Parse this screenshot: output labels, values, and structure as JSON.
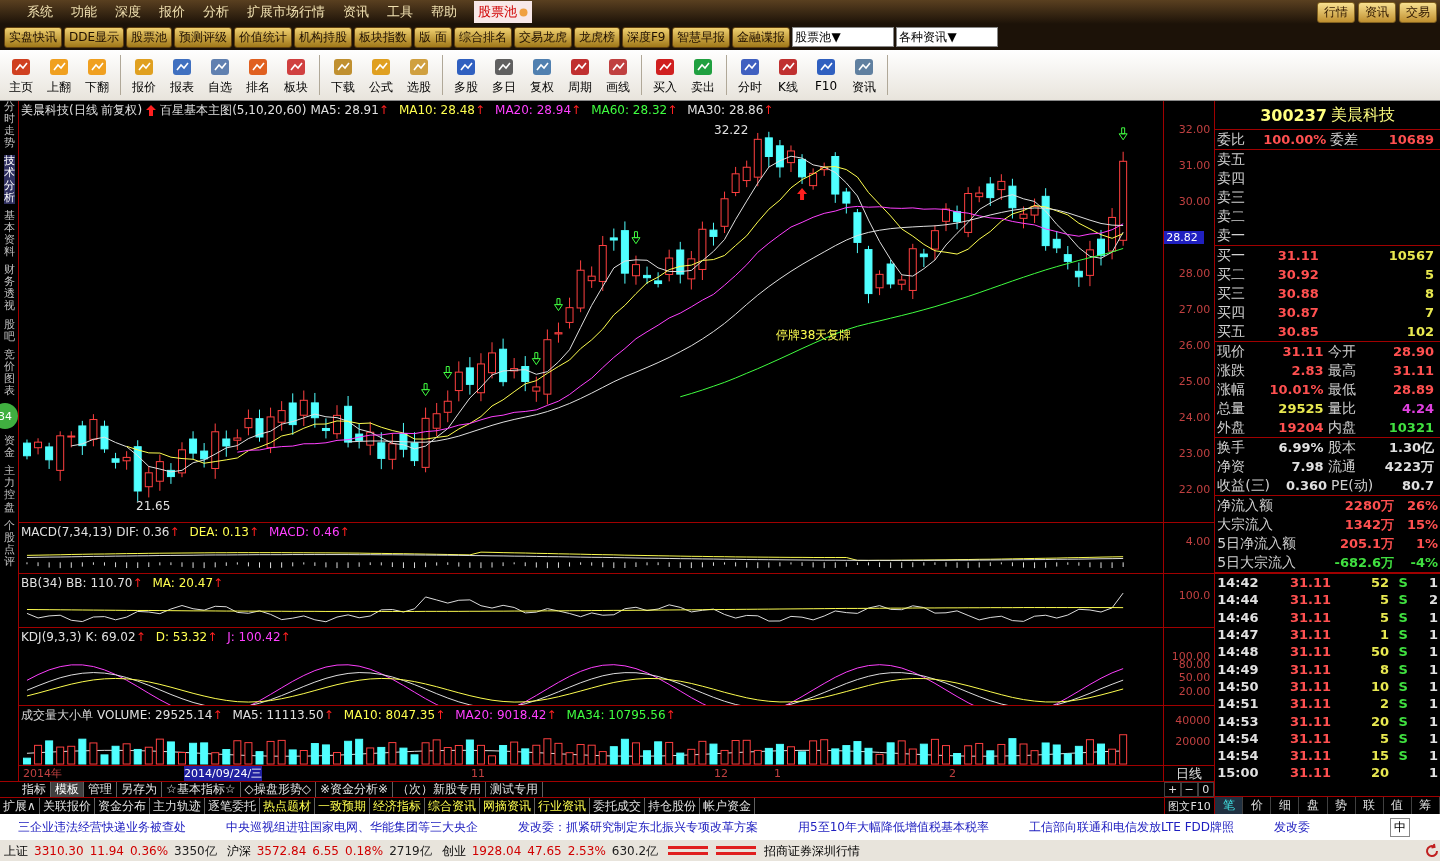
{
  "menu": {
    "items": [
      "系统",
      "功能",
      "深度",
      "报价",
      "分析",
      "扩展市场行情",
      "资讯",
      "工具",
      "帮助"
    ],
    "tab": {
      "label": "股票池",
      "selected": true
    },
    "right_buttons": [
      "行情",
      "资讯",
      "交易"
    ]
  },
  "quickbar": {
    "buttons": [
      "实盘快讯",
      "DDE显示",
      "股票池",
      "预测评级",
      "价值统计",
      "机构持股",
      "板块指数",
      "版 面",
      "综合排名",
      "交易龙虎",
      "龙虎榜",
      "深度F9",
      "智慧早报",
      "金融谍报"
    ],
    "selects": [
      "股票池▼",
      "各种资讯▼"
    ]
  },
  "toolbar": [
    {
      "items": [
        "主页",
        "上翻",
        "下翻"
      ]
    },
    {
      "items": [
        "报价",
        "报表",
        "自选",
        "排名",
        "板块"
      ]
    },
    {
      "items": [
        "下载",
        "公式",
        "选股"
      ]
    },
    {
      "items": [
        "多股",
        "多日",
        "复权",
        "周期",
        "画线"
      ]
    },
    {
      "items": [
        "买入",
        "卖出"
      ]
    },
    {
      "items": [
        "分时",
        "K线",
        "F10",
        "资讯"
      ]
    }
  ],
  "side_tabs": [
    {
      "label": "分时走势",
      "selected": false
    },
    {
      "label": "技术分析",
      "selected": true
    },
    {
      "label": "基本资料",
      "selected": false
    },
    {
      "label": "财务透视",
      "selected": false
    },
    {
      "label": "股吧",
      "selected": false
    },
    {
      "label": "竞价图表",
      "selected": false
    },
    {
      "label": "资金",
      "selected": false
    },
    {
      "label": "主力控盘",
      "selected": false
    },
    {
      "label": "个股点评",
      "selected": false
    }
  ],
  "side_badge": "34",
  "panes": [
    {
      "kind": "price",
      "legend": [
        {
          "label": "美晨科技(日线 前复权)",
          "color": "#e0e0e0"
        },
        {
          "label": "百星基本主图(5,10,20,60)",
          "color": "#e0e0e0",
          "kind": "indicator"
        },
        {
          "label": "MA5: 28.91",
          "color": "#e0e0e0",
          "arrow": "↑"
        },
        {
          "label": "MA10: 28.48",
          "color": "#ffff50",
          "arrow": "↑"
        },
        {
          "label": "MA20: 28.94",
          "color": "#ff40ff",
          "arrow": "↑"
        },
        {
          "label": "MA60: 28.32",
          "color": "#40ff40",
          "arrow": "↑"
        },
        {
          "label": "MA30: 28.86",
          "color": "#e0e0e0",
          "arrow": "↑"
        }
      ],
      "yticks": [
        "32.00",
        "31.00",
        "30.00",
        "28.00",
        "27.00",
        "26.00",
        "25.00",
        "24.00",
        "23.00",
        "22.00"
      ],
      "current": "28.82",
      "annotations": [
        "32.22",
        "21.65",
        "停牌38天复牌"
      ]
    },
    {
      "kind": "macd",
      "legend": [
        {
          "label": "MACD(7,34,13)",
          "color": "#e0e0e0"
        },
        {
          "label": "DIF: 0.36",
          "color": "#e0e0e0",
          "arrow": "↑"
        },
        {
          "label": "DEA: 0.13",
          "color": "#ffff50",
          "arrow": "↑"
        },
        {
          "label": "MACD: 0.46",
          "color": "#ff40ff",
          "arrow": "↑"
        }
      ],
      "yticks": [
        "4.00"
      ]
    },
    {
      "kind": "bb",
      "legend": [
        {
          "label": "BB(34)",
          "color": "#e0e0e0"
        },
        {
          "label": "BB: 110.70",
          "color": "#e0e0e0",
          "arrow": "↑"
        },
        {
          "label": "MA: 20.47",
          "color": "#ffff50",
          "arrow": "↑"
        }
      ],
      "yticks": [
        "100.0"
      ]
    },
    {
      "kind": "kdj",
      "legend": [
        {
          "label": "KDJ(9,3,3)",
          "color": "#e0e0e0"
        },
        {
          "label": "K: 69.02",
          "color": "#e0e0e0",
          "arrow": "↑"
        },
        {
          "label": "D: 53.32",
          "color": "#ffff50",
          "arrow": "↑"
        },
        {
          "label": "J: 100.42",
          "color": "#ff40ff",
          "arrow": "↑"
        }
      ],
      "yticks": [
        "100.00",
        "80.00",
        "50.00",
        "20.00"
      ]
    },
    {
      "kind": "volume",
      "legend": [
        {
          "label": "成交量大小单"
        },
        {
          "label": "VOLUME: 29525.14",
          "color": "#e0e0e0",
          "arrow": "↑"
        },
        {
          "label": "MA5: 11113.50",
          "color": "#e0e0e0",
          "arrow": "↑"
        },
        {
          "label": "MA10: 8047.35",
          "color": "#ffff50",
          "arrow": "↑"
        },
        {
          "label": "MA20: 9018.42",
          "color": "#ff40ff",
          "arrow": "↑"
        },
        {
          "label": "MA34: 10795.56",
          "color": "#40ff40",
          "arrow": "↑"
        }
      ],
      "yticks": [
        "40000",
        "20000"
      ]
    }
  ],
  "date_axis": [
    {
      "label": "2014年",
      "selected": false
    },
    {
      "label": "2014/09/24/三",
      "selected": true
    },
    {
      "label": "11",
      "selected": false
    },
    {
      "label": "12",
      "selected": false
    },
    {
      "label": "1",
      "selected": false
    },
    {
      "label": "2",
      "selected": false
    }
  ],
  "period": "日线",
  "zoom_buttons": [
    "+",
    "−",
    "0"
  ],
  "template_tabs": [
    {
      "label": "指标",
      "selected": false
    },
    {
      "label": "模板",
      "selected": true
    },
    {
      "label": "管理",
      "selected": false
    },
    {
      "label": "另存为",
      "selected": false
    },
    {
      "label": "☆基本指标☆",
      "selected": false
    },
    {
      "label": "◇操盘形势◇",
      "selected": false
    },
    {
      "label": "※资金分析※",
      "selected": false
    },
    {
      "label": "（次）新股专用",
      "selected": false
    },
    {
      "label": "测试专用",
      "selected": false
    }
  ],
  "bottom_tabs": [
    {
      "label": "扩展∧",
      "highlighted": false
    },
    {
      "label": "关联报价",
      "highlighted": false
    },
    {
      "label": "资金分布",
      "highlighted": false
    },
    {
      "label": "主力轨迹",
      "highlighted": false
    },
    {
      "label": "逐笔委托",
      "highlighted": false
    },
    {
      "label": "热点题材",
      "highlighted": true
    },
    {
      "label": "一致预期",
      "highlighted": true
    },
    {
      "label": "经济指标",
      "highlighted": true
    },
    {
      "label": "综合资讯",
      "highlighted": true
    },
    {
      "label": "网摘资讯",
      "highlighted": true
    },
    {
      "label": "行业资讯",
      "highlighted": true
    },
    {
      "label": "委托成交",
      "highlighted": false
    },
    {
      "label": "持仓股份",
      "highlighted": false
    },
    {
      "label": "帐户资金",
      "highlighted": false
    }
  ],
  "f10_button": "图文F10",
  "quote": {
    "code": "300237",
    "name": "美晨科技"
  },
  "ratio": {
    "label": "委比",
    "value": "100.00%",
    "label2": "委差",
    "value2": "10689"
  },
  "sell": [
    "卖五",
    "卖四",
    "卖三",
    "卖二",
    "卖一"
  ],
  "buy": [
    {
      "label": "买一",
      "price": "31.11",
      "volume": "10567"
    },
    {
      "label": "买二",
      "price": "30.92",
      "volume": "5"
    },
    {
      "label": "买三",
      "price": "30.88",
      "volume": "8"
    },
    {
      "label": "买四",
      "price": "30.87",
      "volume": "7"
    },
    {
      "label": "买五",
      "price": "30.85",
      "volume": "102"
    }
  ],
  "stats": [
    {
      "cells": [
        {
          "label": "现价",
          "value": "31.11",
          "color": "#ff5050"
        },
        {
          "label": "今开",
          "value": "28.90",
          "color": "#ff5050"
        }
      ]
    },
    {
      "cells": [
        {
          "label": "涨跌",
          "value": "2.83",
          "color": "#ff5050"
        },
        {
          "label": "最高",
          "value": "31.11",
          "color": "#ff5050"
        }
      ]
    },
    {
      "cells": [
        {
          "label": "涨幅",
          "value": "10.01%",
          "color": "#ff5050"
        },
        {
          "label": "最低",
          "value": "28.89",
          "color": "#ff5050"
        }
      ]
    },
    {
      "cells": [
        {
          "label": "总量",
          "value": "29525",
          "color": "#e8e850"
        },
        {
          "label": "量比",
          "value": "4.24",
          "color": "#e040e0"
        }
      ]
    },
    {
      "cells": [
        {
          "label": "外盘",
          "value": "19204",
          "color": "#ff5050"
        },
        {
          "label": "内盘",
          "value": "10321",
          "color": "#40e040"
        }
      ]
    }
  ],
  "info": [
    {
      "label": "换手",
      "value": "6.99%",
      "label2": "股本",
      "value2": "1.30亿"
    },
    {
      "label": "净资",
      "value": "7.98",
      "label2": "流通",
      "value2": "4223万"
    },
    {
      "label": "收益(三)",
      "value": "0.360",
      "label2": "PE(动)",
      "value2": "80.7"
    }
  ],
  "flows": [
    {
      "label": "净流入额",
      "amount": "2280万",
      "pct": "26%",
      "color": "#ff5050"
    },
    {
      "label": "大宗流入",
      "amount": "1342万",
      "pct": "15%",
      "color": "#ff5050"
    },
    {
      "label": "5日净流入额",
      "amount": "205.1万",
      "pct": "1%",
      "color": "#ff5050"
    },
    {
      "label": "5日大宗流入",
      "amount": "-682.6万",
      "pct": "-4%",
      "color": "#40e040"
    }
  ],
  "trades": [
    {
      "time": "14:42",
      "price": "31.11",
      "volume": "52",
      "side": "S",
      "column_5": "1"
    },
    {
      "time": "14:44",
      "price": "31.11",
      "volume": "5",
      "side": "S",
      "column_5": "2"
    },
    {
      "time": "14:46",
      "price": "31.11",
      "volume": "5",
      "side": "S",
      "column_5": "1"
    },
    {
      "time": "14:47",
      "price": "31.11",
      "volume": "1",
      "side": "S",
      "column_5": "1"
    },
    {
      "time": "14:48",
      "price": "31.11",
      "volume": "50",
      "side": "S",
      "column_5": "1"
    },
    {
      "time": "14:49",
      "price": "31.11",
      "volume": "8",
      "side": "S",
      "column_5": "1"
    },
    {
      "time": "14:50",
      "price": "31.11",
      "volume": "10",
      "side": "S",
      "column_5": "1"
    },
    {
      "time": "14:51",
      "price": "31.11",
      "volume": "2",
      "side": "S",
      "column_5": "1"
    },
    {
      "time": "14:53",
      "price": "31.11",
      "volume": "20",
      "side": "S",
      "column_5": "1"
    },
    {
      "time": "14:54",
      "price": "31.11",
      "volume": "5",
      "side": "S",
      "column_5": "1"
    },
    {
      "time": "14:54",
      "price": "31.11",
      "volume": "15",
      "side": "S",
      "column_5": "1"
    },
    {
      "time": "15:00",
      "price": "31.11",
      "volume": "20",
      "column_5": "1"
    }
  ],
  "detail_tabs": [
    {
      "label": "笔",
      "selected": true
    },
    {
      "label": "价",
      "selected": false
    },
    {
      "label": "细",
      "selected": false
    },
    {
      "label": "盘",
      "selected": false
    },
    {
      "label": "势",
      "selected": false
    },
    {
      "label": "联",
      "selected": false
    },
    {
      "label": "值",
      "selected": false
    },
    {
      "label": "筹",
      "selected": false
    }
  ],
  "news": [
    "三企业违法经营快递业务被查处",
    "中央巡视组进驻国家电网、华能集团等三大央企",
    "发改委：抓紧研究制定东北振兴专项改革方案",
    "用5至10年大幅降低增值税基本税率",
    "工信部向联通和电信发放LTE FDD牌照",
    "发改委"
  ],
  "ime": "中",
  "status_bar": {
    "indices": [
      {
        "name": "上证",
        "value": "3310.30",
        "change": "11.94",
        "pct": "0.36%",
        "turnover": "3350亿"
      },
      {
        "name": "沪深",
        "value": "3572.84",
        "change": "6.55",
        "pct": "0.18%",
        "turnover": "2719亿"
      },
      {
        "name": "创业",
        "value": "1928.04",
        "change": "47.65",
        "pct": "2.53%",
        "turnover": "630.2亿"
      }
    ],
    "broker": "招商证券深圳行情"
  }
}
